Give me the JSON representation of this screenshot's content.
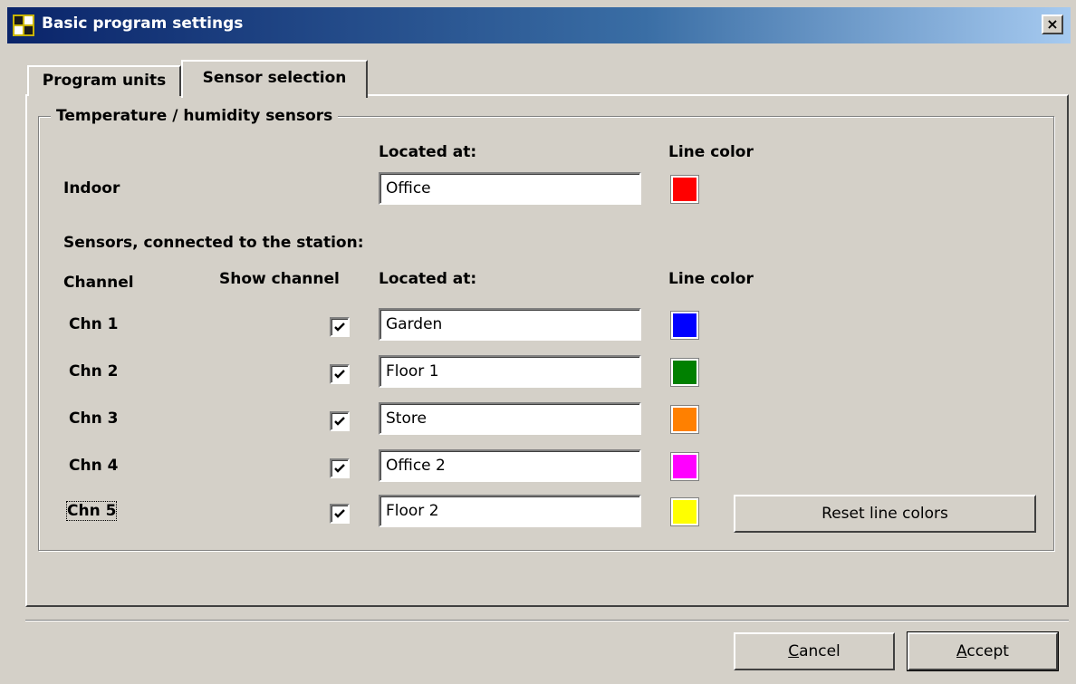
{
  "window": {
    "title": "Basic program settings",
    "close_label": "×"
  },
  "tabs": [
    {
      "label": "Program units"
    },
    {
      "label": "Sensor selection"
    }
  ],
  "group": {
    "title": "Temperature / humidity sensors"
  },
  "headers": {
    "located_at": "Located at:",
    "line_color": "Line color",
    "channel": "Channel",
    "show_channel": "Show channel"
  },
  "indoor": {
    "label": "Indoor",
    "location": "Office",
    "color": "#ff0000"
  },
  "connected_label": "Sensors, connected to the station:",
  "channels": [
    {
      "label": "Chn 1",
      "checked": true,
      "location": "Garden",
      "color": "#0000ff"
    },
    {
      "label": "Chn 2",
      "checked": true,
      "location": "Floor 1",
      "color": "#008000"
    },
    {
      "label": "Chn 3",
      "checked": true,
      "location": "Store",
      "color": "#ff8000"
    },
    {
      "label": "Chn 4",
      "checked": true,
      "location": "Office 2",
      "color": "#ff00ff"
    },
    {
      "label": "Chn 5",
      "checked": true,
      "location": "Floor 2",
      "color": "#ffff00"
    }
  ],
  "buttons": {
    "reset": "Reset line colors",
    "cancel": "Cancel",
    "accept": "Accept"
  }
}
